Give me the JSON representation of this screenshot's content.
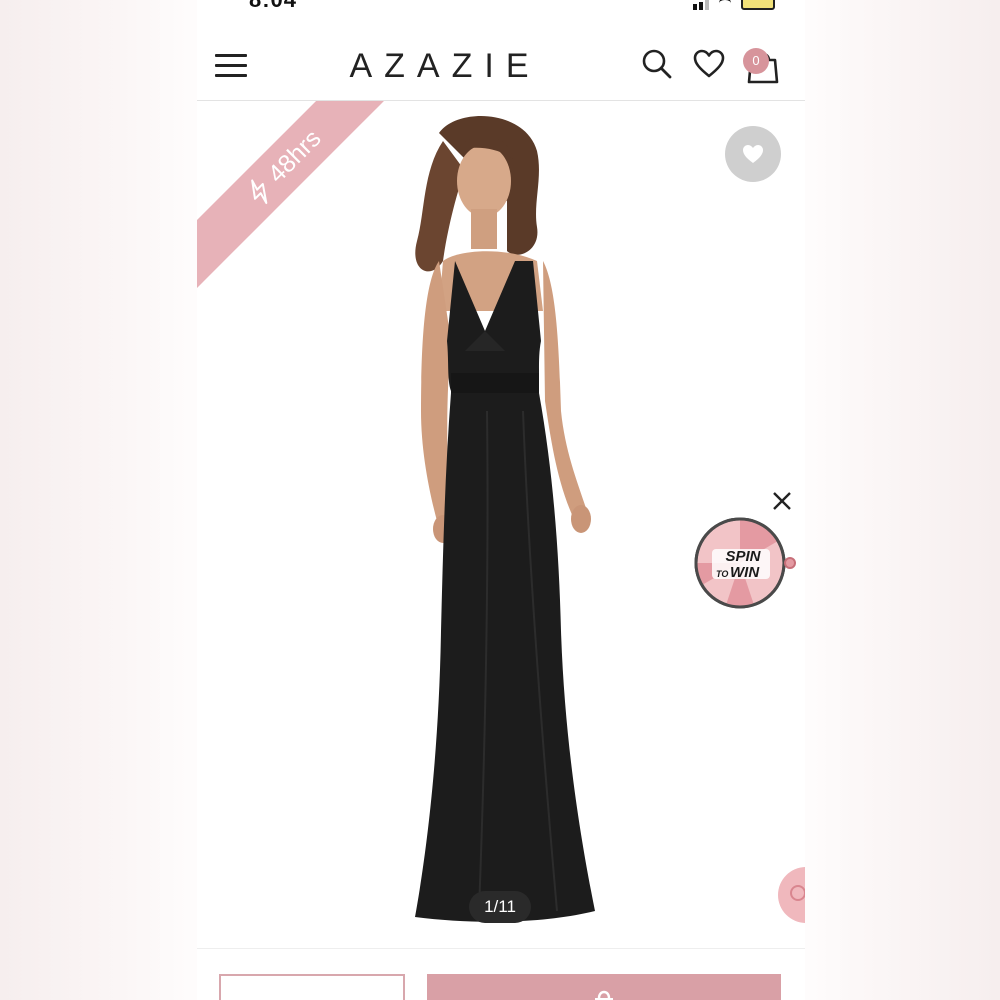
{
  "status_bar": {
    "time": "8:04"
  },
  "header": {
    "logo": "AZAZIE",
    "cart_count": "0"
  },
  "gallery": {
    "ribbon_label": "48hrs",
    "image_counter": "1/11"
  },
  "promo": {
    "spin_line1": "SPIN",
    "spin_line2": "TO",
    "spin_line3": "WIN"
  },
  "colors": {
    "accent_pink": "#d7949b",
    "ribbon_pink": "#e7b2b8",
    "dress_black": "#1c1c1c"
  },
  "icons": [
    "hamburger-menu-icon",
    "search-icon",
    "heart-icon",
    "shopping-bag-icon",
    "lightning-icon",
    "close-icon",
    "chat-icon"
  ]
}
